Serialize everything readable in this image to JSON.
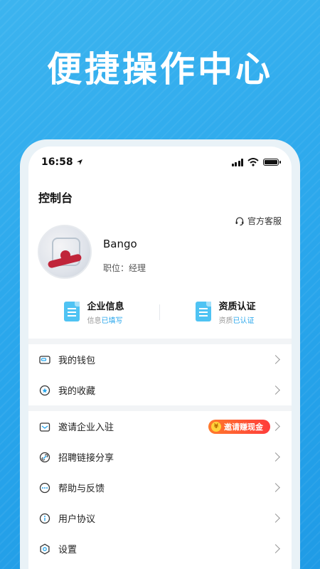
{
  "headline": "便捷操作中心",
  "status_bar": {
    "time": "16:58"
  },
  "page_title": "控制台",
  "service": {
    "label": "官方客服"
  },
  "profile": {
    "name": "Bango",
    "role": "职位：经理"
  },
  "quick": [
    {
      "title": "企业信息",
      "sub_prefix": "信息",
      "sub_status": "已填写"
    },
    {
      "title": "资质认证",
      "sub_prefix": "资质",
      "sub_status": "已认证"
    }
  ],
  "menu_group1": [
    {
      "label": "我的钱包",
      "icon": "wallet-icon"
    },
    {
      "label": "我的收藏",
      "icon": "star-icon"
    }
  ],
  "menu_group2": [
    {
      "label": "邀请企业入驻",
      "icon": "invite-icon"
    },
    {
      "label": "招聘链接分享",
      "icon": "link-icon"
    },
    {
      "label": "帮助与反馈",
      "icon": "help-icon"
    },
    {
      "label": "用户协议",
      "icon": "info-icon"
    },
    {
      "label": "设置",
      "icon": "gear-icon"
    }
  ],
  "promo": {
    "coin": "¥",
    "label": "邀请赚现金"
  },
  "colors": {
    "accent": "#27a6ec",
    "promo_start": "#ff7a2c",
    "promo_end": "#ff3b3b"
  }
}
